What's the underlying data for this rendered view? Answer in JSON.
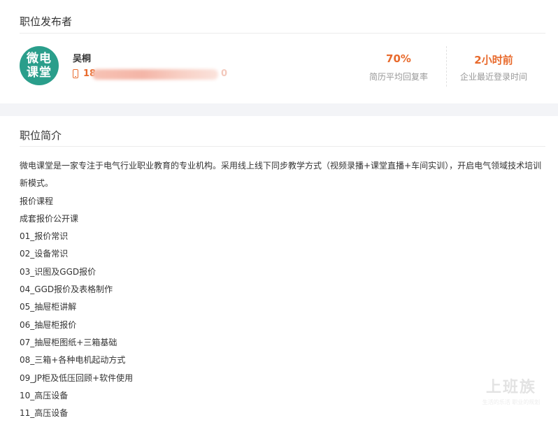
{
  "publisher": {
    "section_title": "职位发布者",
    "avatar_text_line1": "微电",
    "avatar_text_line2": "课堂",
    "name": "吴桐",
    "phone_visible_start": "18",
    "phone_visible_end": "0",
    "reply_rate": "70%",
    "reply_rate_label": "简历平均回复率",
    "last_login": "2小时前",
    "last_login_label": "企业最近登录时间"
  },
  "intro": {
    "section_title": "职位简介",
    "lines": [
      "微电课堂是一家专注于电气行业职业教育的专业机构。采用线上线下同步教学方式（视频录播+课堂直播+车间实训），开启电气领域技术培训新模式。",
      "报价课程",
      "成套报价公开课",
      "01_报价常识",
      "02_设备常识",
      "03_识图及GGD报价",
      "04_GGD报价及表格制作",
      "05_抽屉柜讲解",
      "06_抽屉柜报价",
      "07_抽屉柜图纸+三箱基础",
      "08_三箱+各种电机起动方式",
      "09_JP柜及低压回顾+软件使用",
      "10_高压设备",
      "11_高压设备"
    ]
  },
  "watermark": {
    "logo": "上班族",
    "slogan": "生活的乐活 职业的规划"
  },
  "colors": {
    "accent": "#e86a2c",
    "avatar_bg": "#2a9e8b"
  }
}
